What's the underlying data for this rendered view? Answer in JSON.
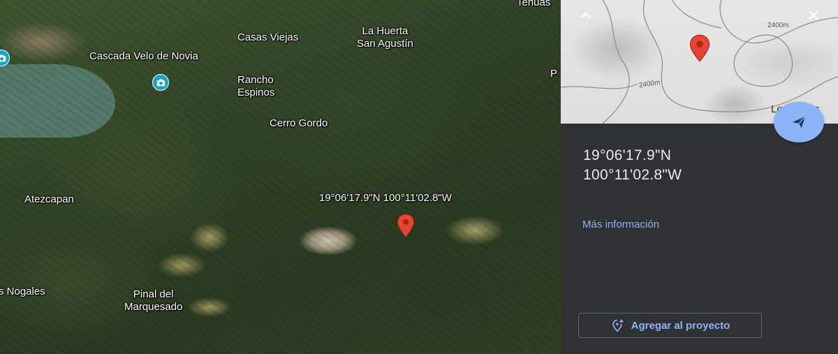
{
  "map": {
    "places": [
      {
        "name": "Casas Viejas"
      },
      {
        "name": "La Huerta\nSan Agustín"
      },
      {
        "name": "Cascada Velo de Novia"
      },
      {
        "name": "Rancho\nEspinos"
      },
      {
        "name": "Cerro Gordo"
      },
      {
        "name": "Atezcapan"
      },
      {
        "name": "Pinal del\nMarquesado"
      },
      {
        "name": "s Nogales"
      },
      {
        "name": "Tehuas"
      },
      {
        "name": "P"
      }
    ],
    "pin_label": "19°06'17.9\"N 100°11'02.8\"W"
  },
  "panel": {
    "minimap": {
      "contour_labels": [
        "2400m",
        "2400m"
      ],
      "place": "Los Pozos"
    },
    "lat": "19°06'17.9\"N",
    "lng": "100°11'02.8\"W",
    "more_info": "Más información",
    "add_to_project": "Agregar al proyecto"
  },
  "icons": {
    "collapse": "chevron-up-icon",
    "close": "close-icon",
    "navigate": "send-icon",
    "add": "add-location-icon",
    "poi": "camera-icon",
    "pin": "map-pin-icon"
  },
  "colors": {
    "accent": "#8ab4f8",
    "pin": "#ea4335",
    "panel_bg": "#2f3133",
    "poi": "#19a5c7"
  }
}
